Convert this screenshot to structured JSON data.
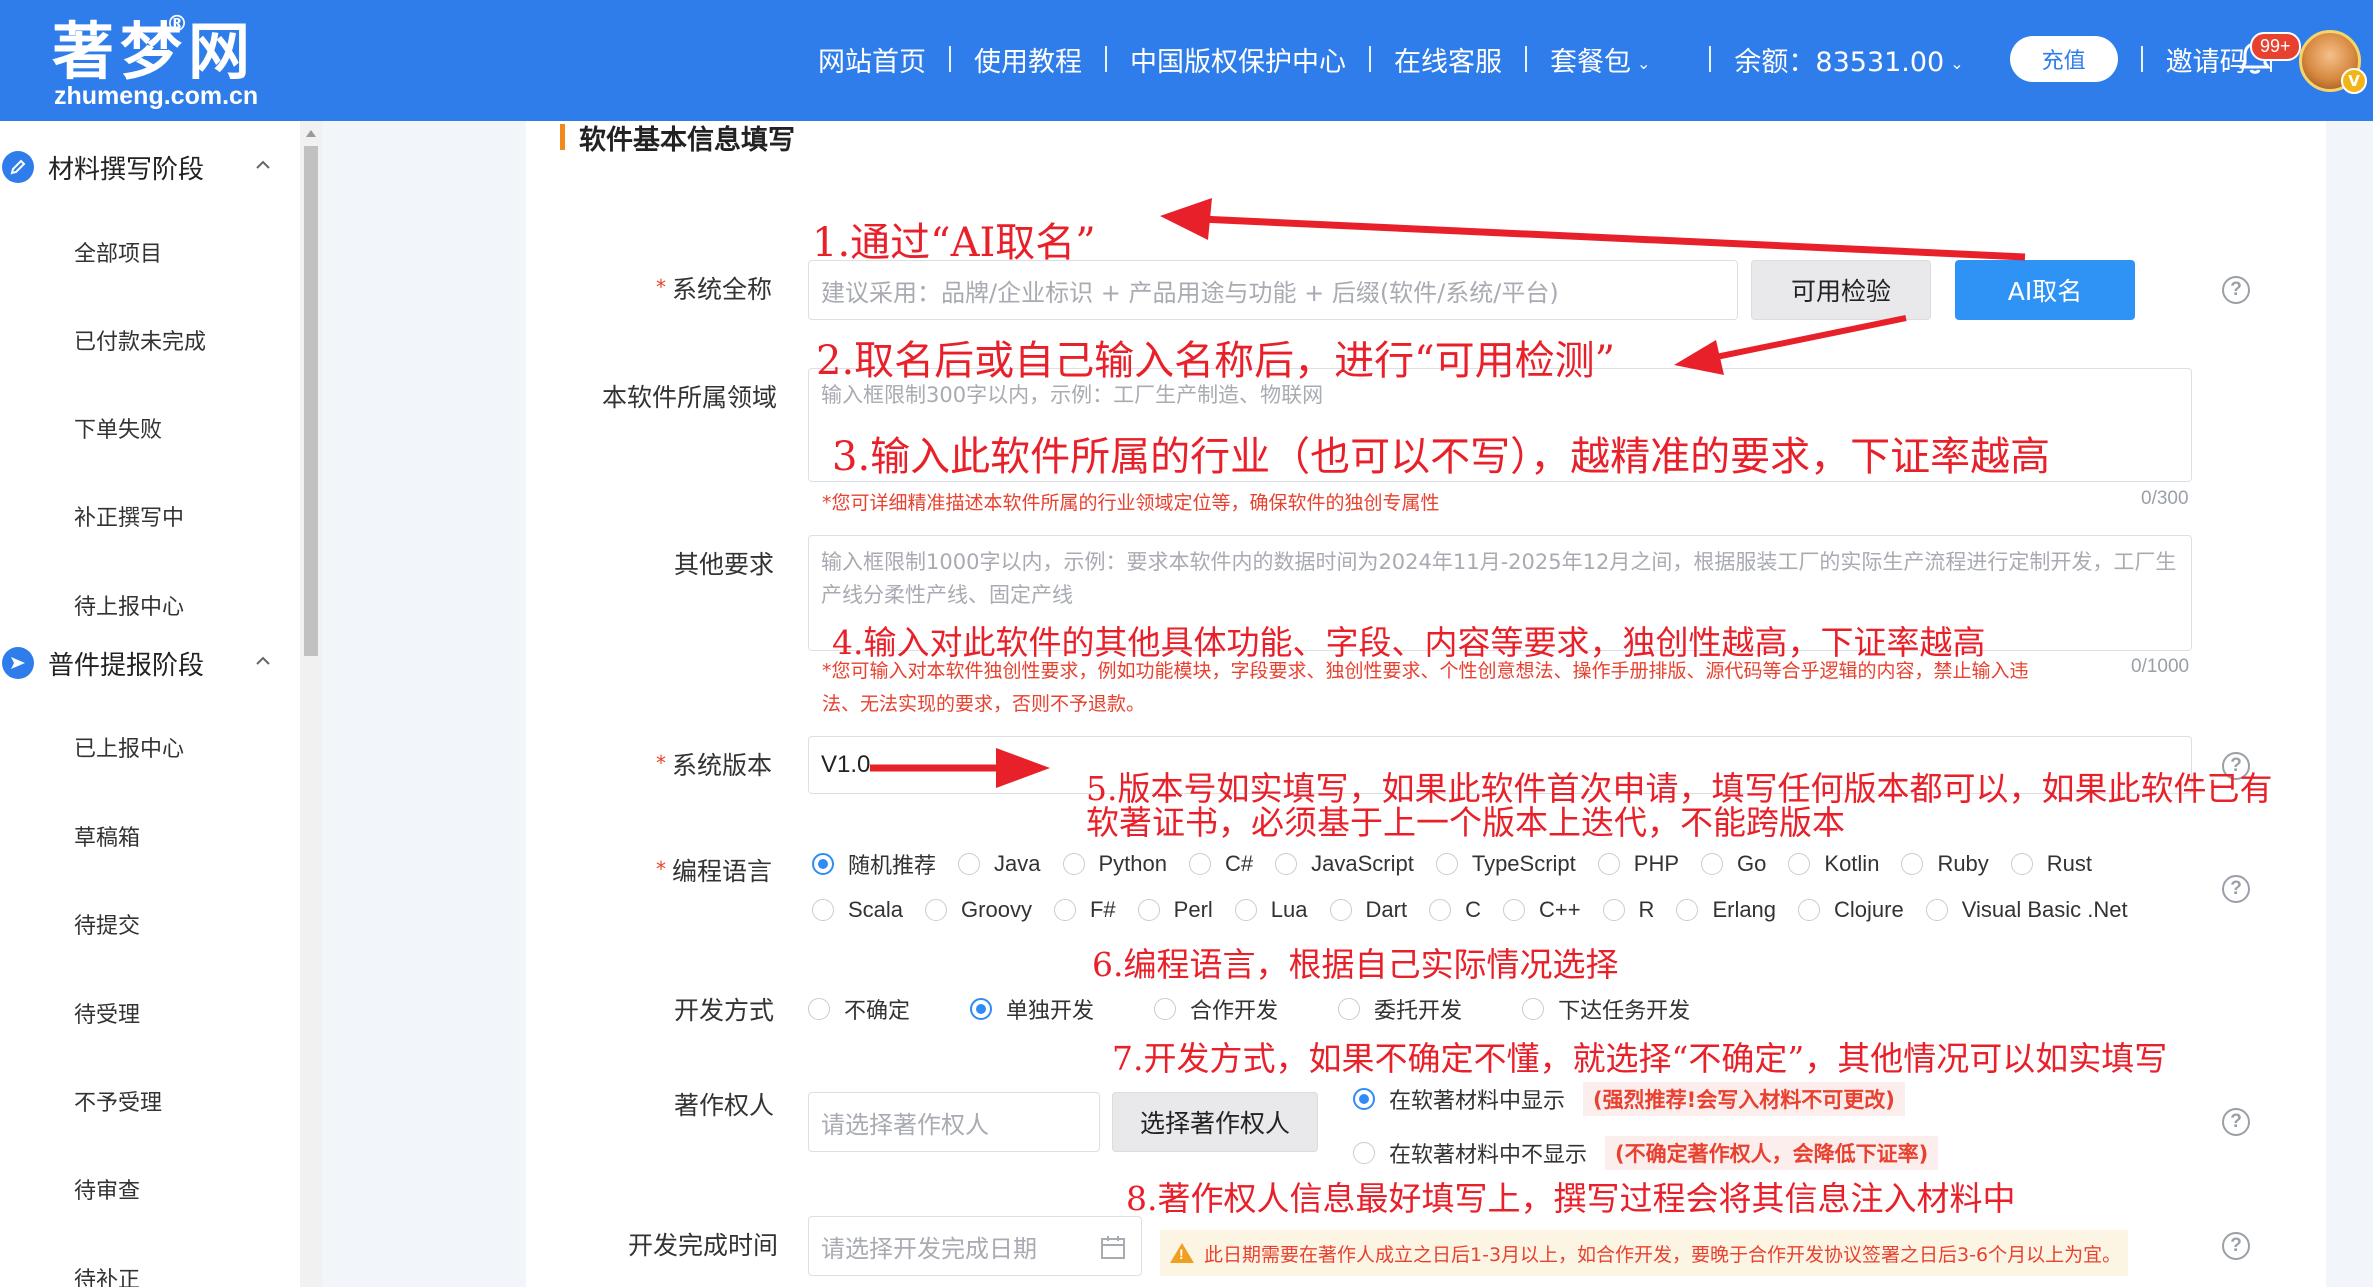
{
  "header": {
    "logo_cn": "著梦网",
    "logo_reg": "®",
    "logo_en": "zhumeng.com.cn",
    "nav": [
      "网站首页",
      "使用教程",
      "中国版权保护中心",
      "在线客服"
    ],
    "package_label": "套餐包",
    "balance_label": "余额：83531.00",
    "recharge_label": "充值",
    "invite_label": "邀请码",
    "notif_badge": "99+",
    "avatar_badge": "V",
    "brand_color": "#2f7dea"
  },
  "sidebar": {
    "group1_title": "材料撰写阶段",
    "group1_items": [
      "全部项目",
      "已付款未完成",
      "下单失败",
      "补正撰写中",
      "待上报中心"
    ],
    "group2_title": "普件提报阶段",
    "group2_items": [
      "已上报中心",
      "草稿箱",
      "待提交",
      "待受理",
      "不予受理",
      "待审查",
      "待补正"
    ]
  },
  "form": {
    "section_title": "软件基本信息填写",
    "required_mark": "*",
    "help_symbol": "?",
    "system_name": {
      "label": "系统全称",
      "placeholder": "建议采用：品牌/企业标识 + 产品用途与功能 + 后缀(软件/系统/平台)",
      "check_button": "可用检验",
      "ai_button": "AI取名"
    },
    "domain": {
      "label": "本软件所属领域",
      "placeholder": "输入框限制300字以内，示例：工厂生产制造、物联网",
      "hint": "*您可详细精准描述本软件所属的行业领域定位等，确保软件的独创专属性",
      "count": "0/300"
    },
    "other": {
      "label": "其他要求",
      "placeholder": "输入框限制1000字以内，示例：要求本软件内的数据时间为2024年11月-2025年12月之间，根据服装工厂的实际生产流程进行定制开发，工厂生产线分柔性产线、固定产线",
      "hint_line1": "*您可输入对本软件独创性要求，例如功能模块，字段要求、独创性要求、个性创意想法、操作手册排版、源代码等合乎逻辑的内容，禁止输入违",
      "hint_line2": "法、无法实现的要求，否则不予退款。",
      "count": "0/1000"
    },
    "version": {
      "label": "系统版本",
      "value": "V1.0"
    },
    "language": {
      "label": "编程语言",
      "row1": [
        "随机推荐",
        "Java",
        "Python",
        "C#",
        "JavaScript",
        "TypeScript",
        "PHP",
        "Go",
        "Kotlin",
        "Ruby",
        "Rust"
      ],
      "row2": [
        "Scala",
        "Groovy",
        "F#",
        "Perl",
        "Lua",
        "Dart",
        "C",
        "C++",
        "R",
        "Erlang",
        "Clojure",
        "Visual Basic .Net"
      ],
      "selected": "随机推荐"
    },
    "dev_mode": {
      "label": "开发方式",
      "options": [
        "不确定",
        "单独开发",
        "合作开发",
        "委托开发",
        "下达任务开发"
      ],
      "selected": "单独开发"
    },
    "owner": {
      "label": "著作权人",
      "placeholder": "请选择著作权人",
      "select_button": "选择著作权人",
      "show_label": "在软著材料中显示",
      "show_tag": "(强烈推荐!会写入材料不可更改)",
      "hide_label": "在软著材料中不显示",
      "hide_tag": "(不确定著作权人，会降低下证率)"
    },
    "finish_date": {
      "label": "开发完成时间",
      "placeholder": "请选择开发完成日期",
      "warning": "此日期需要在著作人成立之日后1-3月以上，如合作开发，要晚于合作开发协议签署之日后3-6个月以上为宜。"
    }
  },
  "annotations": {
    "a1": "1.通过“AI取名”",
    "a2": "2.取名后或自己输入名称后，进行“可用检测”",
    "a3": "3.输入此软件所属的行业（也可以不写），越精准的要求，下证率越高",
    "a4": "4.输入对此软件的其他具体功能、字段、内容等要求，独创性越高，下证率越高",
    "a5_line1": "5.版本号如实填写，如果此软件首次申请，填写任何版本都可以，如果此软件已有",
    "a5_line2": "软著证书，必须基于上一个版本上迭代，不能跨版本",
    "a6": "6.编程语言，根据自己实际情况选择",
    "a7": "7.开发方式，如果不确定不懂，就选择“不确定”，其他情况可以如实填写",
    "a8": "8.著作权人信息最好填写上，撰写过程会将其信息注入材料中",
    "color": "#e8202a"
  }
}
